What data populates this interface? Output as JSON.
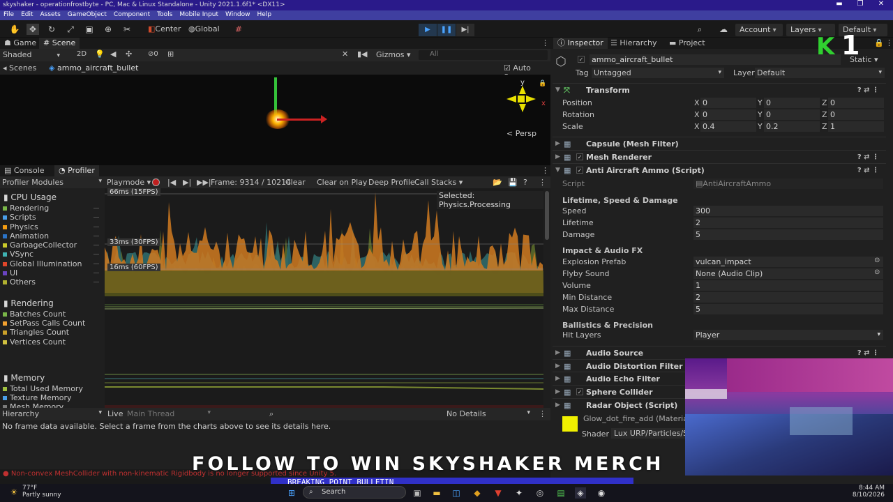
{
  "window": {
    "title": "skyshaker - operationfrostbyte - PC, Mac & Linux Standalone - Unity 2021.1.6f1* <DX11>"
  },
  "menu": [
    "File",
    "Edit",
    "Assets",
    "GameObject",
    "Component",
    "Tools",
    "Mobile Input",
    "Window",
    "Help"
  ],
  "toolbar": {
    "center": "Center",
    "global": "Global",
    "account": "Account",
    "layers": "Layers",
    "layout": "Default"
  },
  "scene_tabs": {
    "game": "Game",
    "scene": "Scene"
  },
  "scene_bar": {
    "shading": "Shaded",
    "mode2d": "2D",
    "fx_count": "0",
    "gizmos": "Gizmos",
    "search_placeholder": "All"
  },
  "breadcrumb": {
    "scenes": "Scenes",
    "object": "ammo_aircraft_bullet",
    "auto_save": "Auto Save"
  },
  "gizmo": {
    "y": "y",
    "x": "x",
    "persp": "< Persp"
  },
  "console_tabs": {
    "console": "Console",
    "profiler": "Profiler"
  },
  "profiler_bar": {
    "modules": "Profiler Modules",
    "mode": "Playmode",
    "frame": "Frame: 9314 / 10214",
    "clear": "Clear",
    "clear_on_play": "Clear on Play",
    "deep_profile": "Deep Profile",
    "call_stacks": "Call Stacks"
  },
  "cpu": {
    "title": "CPU Usage",
    "items": [
      {
        "label": "Rendering",
        "color": "#7ab648"
      },
      {
        "label": "Scripts",
        "color": "#4a9ee8"
      },
      {
        "label": "Physics",
        "color": "#f39c12"
      },
      {
        "label": "Animation",
        "color": "#2b73c7"
      },
      {
        "label": "GarbageCollector",
        "color": "#c9c92a"
      },
      {
        "label": "VSync",
        "color": "#3fb2b2"
      },
      {
        "label": "Global Illumination",
        "color": "#e0462a"
      },
      {
        "label": "UI",
        "color": "#6a44c2"
      },
      {
        "label": "Others",
        "color": "#b0b030"
      }
    ],
    "lines": [
      "66ms (15FPS)",
      "33ms (30FPS)",
      "16ms (60FPS)"
    ],
    "selected": "Selected: Physics.Processing"
  },
  "rendering": {
    "title": "Rendering",
    "items": [
      "Batches Count",
      "SetPass Calls Count",
      "Triangles Count",
      "Vertices Count"
    ]
  },
  "memory": {
    "title": "Memory",
    "items": [
      "Total Used Memory",
      "Texture Memory",
      "Mesh Memory"
    ]
  },
  "hierarchy_bar": {
    "view": "Hierarchy",
    "live": "Live",
    "thread": "Main Thread",
    "details": "No Details"
  },
  "hierarchy_msg": "No frame data available. Select a frame from the charts above to see its details here.",
  "error_msg": "Non-convex MeshCollider with non-kinematic Rigidbody is no longer supported since Unity 5.",
  "inspector_tabs": {
    "inspector": "Inspector",
    "hierarchy": "Hierarchy",
    "project": "Project"
  },
  "object": {
    "name": "ammo_aircraft_bullet",
    "static": "Static",
    "tag_label": "Tag",
    "tag": "Untagged",
    "layer_label": "Layer",
    "layer": "Default"
  },
  "transform": {
    "title": "Transform",
    "rows": [
      {
        "label": "Position",
        "x": "0",
        "y": "0",
        "z": "0"
      },
      {
        "label": "Rotation",
        "x": "0",
        "y": "0",
        "z": "0"
      },
      {
        "label": "Scale",
        "x": "0.4",
        "y": "0.2",
        "z": "1"
      }
    ]
  },
  "components_top": [
    {
      "name": "Capsule (Mesh Filter)",
      "checkbox": false
    },
    {
      "name": "Mesh Renderer",
      "checkbox": true
    },
    {
      "name": "Anti Aircraft Ammo (Script)",
      "checkbox": true
    }
  ],
  "script": {
    "script_label": "Script",
    "script_value": "AntiAircraftAmmo",
    "h1": "Lifetime, Speed & Damage",
    "f1": [
      {
        "label": "Speed",
        "value": "300"
      },
      {
        "label": "Lifetime",
        "value": "2"
      },
      {
        "label": "Damage",
        "value": "5"
      }
    ],
    "h2": "Impact & Audio FX",
    "f2": [
      {
        "label": "Explosion Prefab",
        "value": "vulcan_impact"
      },
      {
        "label": "Flyby Sound",
        "value": "None (Audio Clip)"
      },
      {
        "label": "Volume",
        "value": "1"
      },
      {
        "label": "Min Distance",
        "value": "2"
      },
      {
        "label": "Max Distance",
        "value": "5"
      }
    ],
    "h3": "Ballistics & Precision",
    "hit_layers_label": "Hit Layers",
    "hit_layers": "Player"
  },
  "components_bottom": [
    {
      "name": "Audio Source",
      "checkbox": false
    },
    {
      "name": "Audio Distortion Filter",
      "checkbox": false
    },
    {
      "name": "Audio Echo Filter",
      "checkbox": false
    },
    {
      "name": "Sphere Collider",
      "checkbox": true
    },
    {
      "name": "Radar Object (Script)",
      "checkbox": false
    }
  ],
  "material": {
    "name": "Glow_dot_fire_add (Material)",
    "shader_label": "Shader",
    "shader": "Lux URP/Particles/Simple"
  },
  "overlay": {
    "banner": "FOLLOW TO WIN SKYSHAKER MERCH",
    "bulletin": "BREAKING POINT BULLETIN",
    "logo_k": "K",
    "logo_1": "1"
  },
  "taskbar": {
    "temp": "77°F",
    "weather": "Partly sunny",
    "search": "Search",
    "time": "8:44 AM",
    "date": "8/10/2026"
  }
}
